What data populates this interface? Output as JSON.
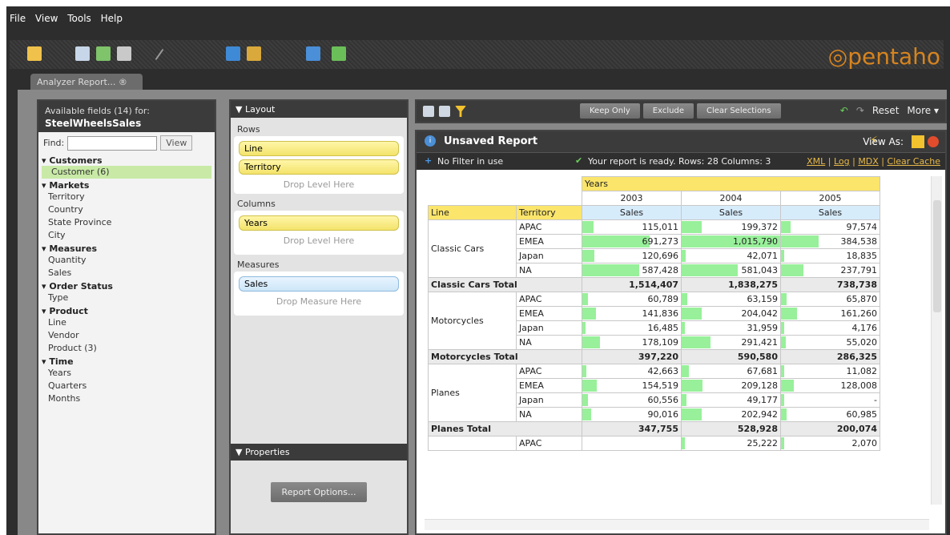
{
  "menu": [
    "File",
    "View",
    "Tools",
    "Help"
  ],
  "logo": "pentaho",
  "tab": "Analyzer Report... ®",
  "fields": {
    "title": "Available fields (14) for:",
    "source": "SteelWheelsSales",
    "find": "Find:",
    "view": "View",
    "groups": [
      {
        "name": "Customers",
        "items": [
          "Customer (6)"
        ]
      },
      {
        "name": "Markets",
        "items": [
          "Territory",
          "Country",
          "State Province",
          "City"
        ]
      },
      {
        "name": "Measures",
        "items": [
          "Quantity",
          "Sales"
        ]
      },
      {
        "name": "Order Status",
        "items": [
          "Type"
        ]
      },
      {
        "name": "Product",
        "items": [
          "Line",
          "Vendor",
          "Product (3)"
        ]
      },
      {
        "name": "Time",
        "items": [
          "Years",
          "Quarters",
          "Months"
        ]
      }
    ]
  },
  "layout": {
    "title": "▼ Layout",
    "rows": "Rows",
    "row_items": [
      "Line",
      "Territory"
    ],
    "drop_level": "Drop Level Here",
    "columns": "Columns",
    "col_items": [
      "Years"
    ],
    "measures": "Measures",
    "measure_items": [
      "Sales"
    ],
    "drop_measure": "Drop Measure Here",
    "properties": "▼ Properties",
    "report_options": "Report Options..."
  },
  "toolbar": {
    "keep_only": "Keep Only",
    "exclude": "Exclude",
    "clear_selections": "Clear Selections",
    "reset": "Reset",
    "more": "More ▾"
  },
  "report": {
    "title": "Unsaved Report",
    "view_as": "View As:",
    "no_filter": "No Filter in use",
    "status": "Your report is ready.  Rows: 28  Columns: 3",
    "links": [
      "XML",
      "Log",
      "MDX",
      "Clear Cache"
    ]
  },
  "grid": {
    "years_label": "Years",
    "years": [
      "2003",
      "2004",
      "2005"
    ],
    "measure": "Sales",
    "line_header": "Line",
    "territory_header": "Territory",
    "rows": [
      {
        "line": "Classic Cars",
        "territories": [
          [
            "APAC",
            "115,011",
            "199,372",
            "97,574"
          ],
          [
            "EMEA",
            "691,273",
            "1,015,790",
            "384,538"
          ],
          [
            "Japan",
            "120,696",
            "42,071",
            "18,835"
          ],
          [
            "NA",
            "587,428",
            "581,043",
            "237,791"
          ]
        ],
        "total": [
          "Classic Cars Total",
          "1,514,407",
          "1,838,275",
          "738,738"
        ]
      },
      {
        "line": "Motorcycles",
        "territories": [
          [
            "APAC",
            "60,789",
            "63,159",
            "65,870"
          ],
          [
            "EMEA",
            "141,836",
            "204,042",
            "161,260"
          ],
          [
            "Japan",
            "16,485",
            "31,959",
            "4,176"
          ],
          [
            "NA",
            "178,109",
            "291,421",
            "55,020"
          ]
        ],
        "total": [
          "Motorcycles Total",
          "397,220",
          "590,580",
          "286,325"
        ]
      },
      {
        "line": "Planes",
        "territories": [
          [
            "APAC",
            "42,663",
            "67,681",
            "11,082"
          ],
          [
            "EMEA",
            "154,519",
            "209,128",
            "128,008"
          ],
          [
            "Japan",
            "60,556",
            "49,177",
            "-"
          ],
          [
            "NA",
            "90,016",
            "202,942",
            "60,985"
          ]
        ],
        "total": [
          "Planes Total",
          "347,755",
          "528,928",
          "200,074"
        ]
      }
    ],
    "partial": [
      "APAC",
      "",
      "25,222",
      "2,070"
    ]
  }
}
